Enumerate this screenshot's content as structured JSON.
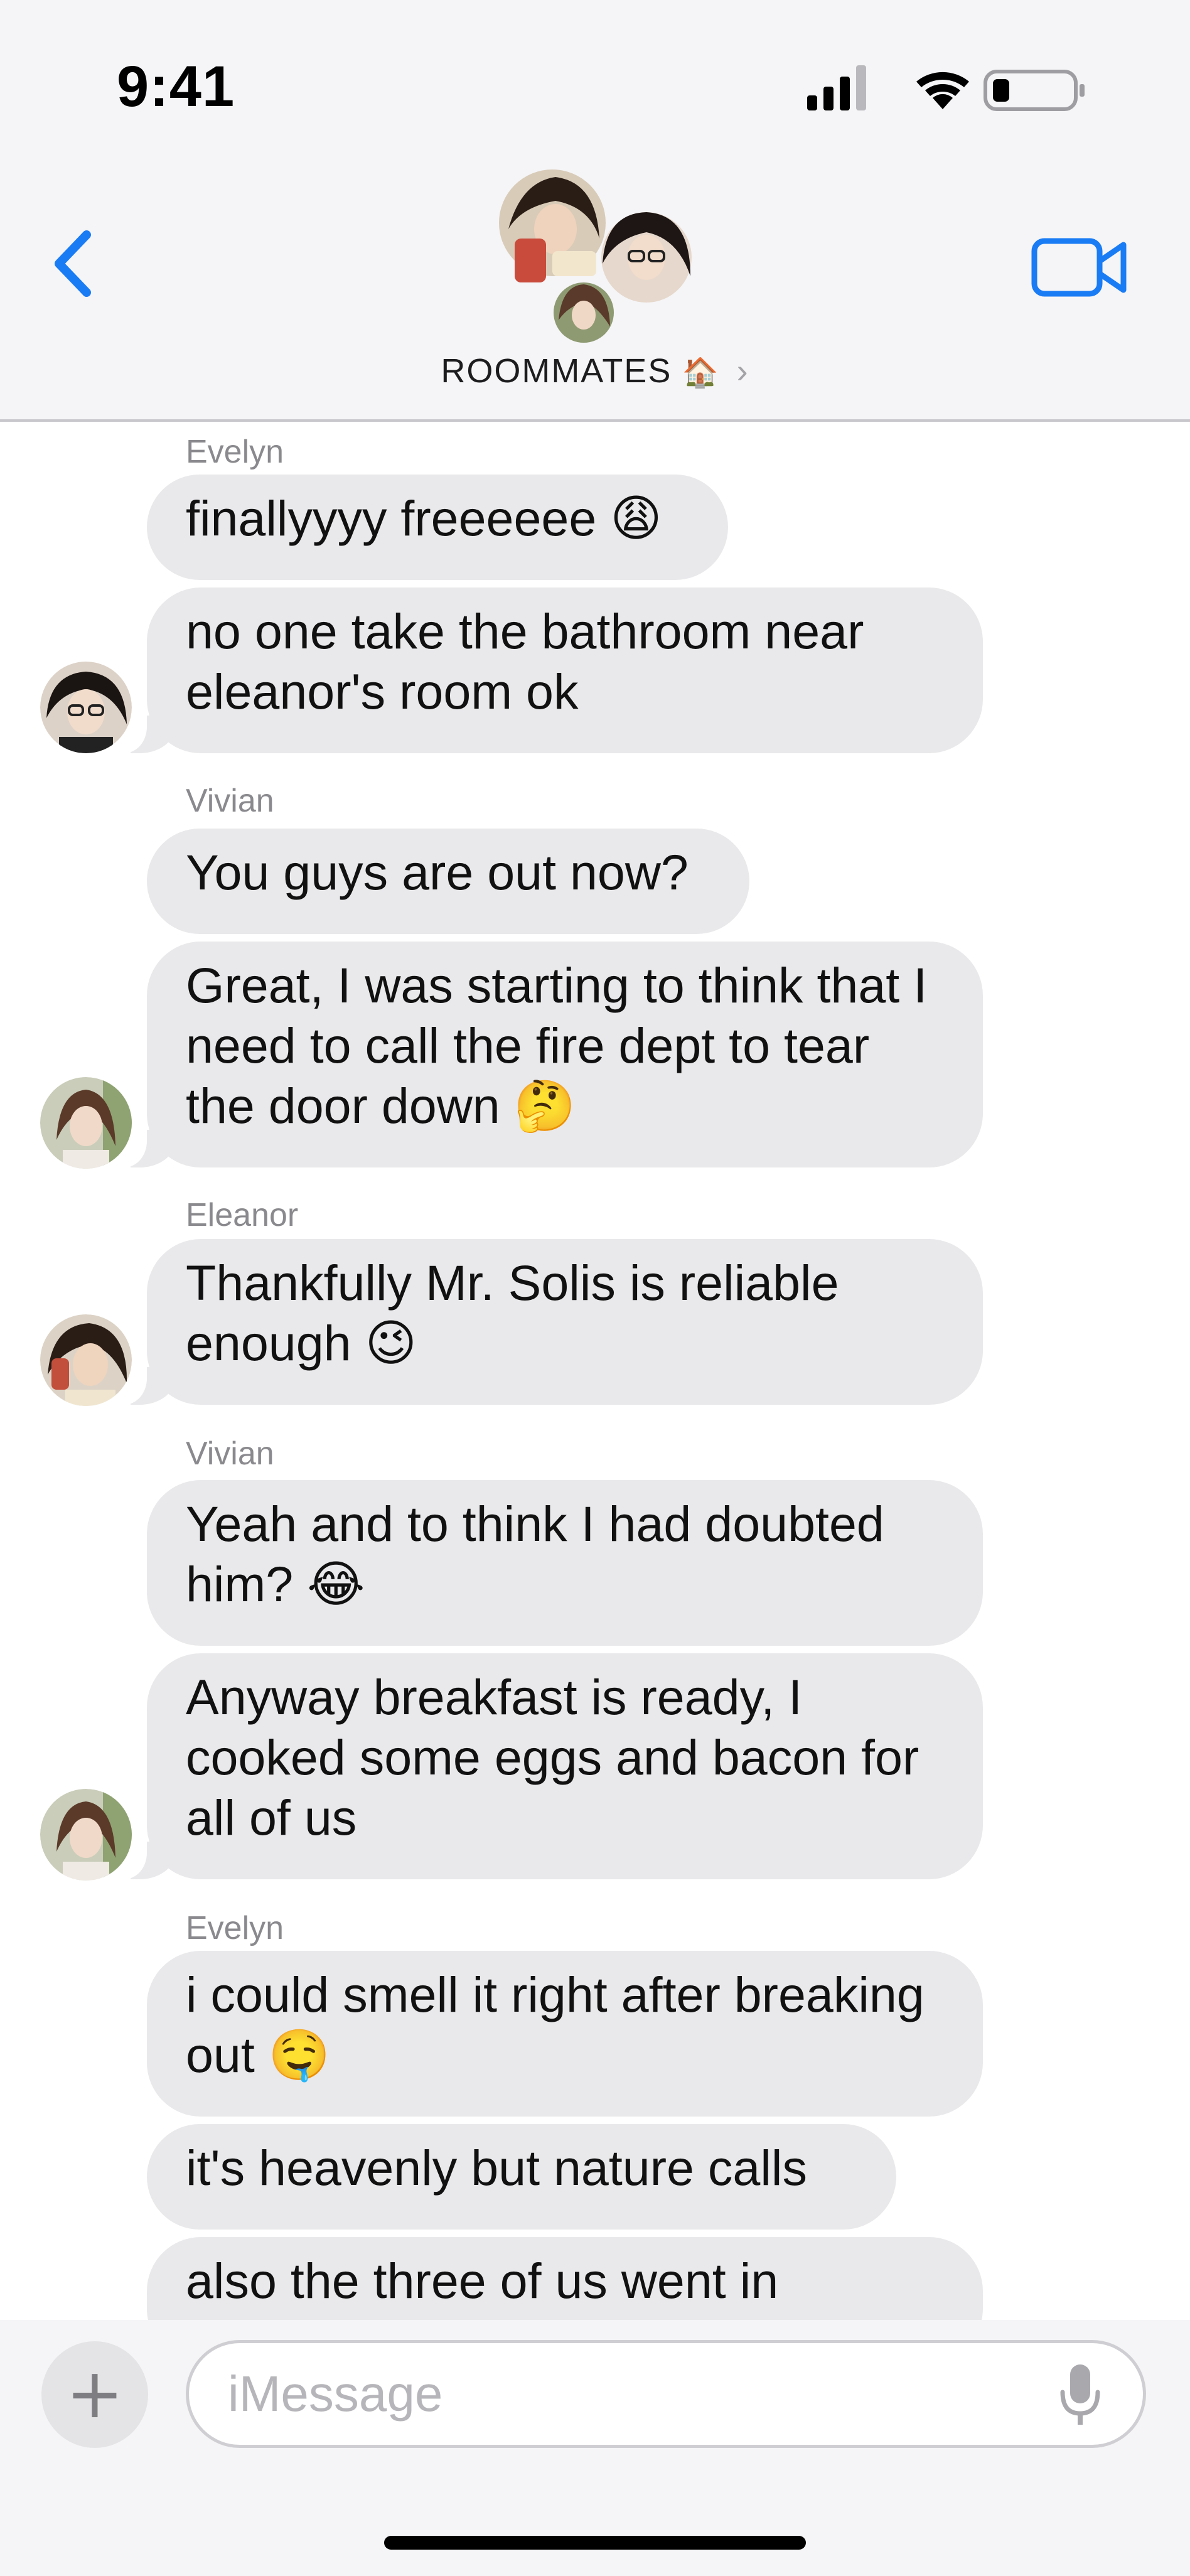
{
  "status_bar": {
    "time": "9:41"
  },
  "header": {
    "group_name": "ROOMMATES",
    "group_emoji": "🏠",
    "back_icon": "chevron-left-icon",
    "video_icon": "video-camera-icon"
  },
  "messages": [
    {
      "sender": "Evelyn",
      "text": "finallyyyy freeeeee 😩"
    },
    {
      "sender": "",
      "text": "no one take the bathroom near eleanor's room ok"
    },
    {
      "sender": "Vivian",
      "text": "You guys are out now?"
    },
    {
      "sender": "",
      "text": "Great, I was starting to think that I need to call the fire dept to tear the door down 🤔"
    },
    {
      "sender": "Eleanor",
      "text": "Thankfully Mr. Solis is reliable enough 😉"
    },
    {
      "sender": "Vivian",
      "text": "Yeah and to think I had doubted him? 😂"
    },
    {
      "sender": "",
      "text": "Anyway breakfast is ready, I cooked some eggs and bacon for all of us"
    },
    {
      "sender": "Evelyn",
      "text": "i could smell it right after breaking out 🤤"
    },
    {
      "sender": "",
      "text": "it's heavenly but nature calls"
    },
    {
      "sender": "",
      "text": "also the three of us went in"
    }
  ],
  "composer": {
    "placeholder": "iMessage",
    "value": ""
  },
  "colors": {
    "accent": "#1a7cf5",
    "bubble_incoming": "#e9e9eb",
    "header_bg": "#f5f5f7"
  }
}
